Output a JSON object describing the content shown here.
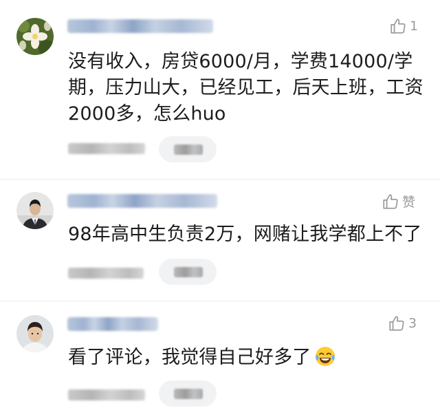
{
  "comments": [
    {
      "avatar": "flower-avatar",
      "like_label": "1",
      "text": "没有收入，房贷6000/月，学费14000/学期，压力山大，已经见工，后天上班，工资2000多，怎么huo"
    },
    {
      "avatar": "suit-man-avatar",
      "like_label": "赞",
      "text": "98年高中生负责2万，网赌让我学都上不了"
    },
    {
      "avatar": "young-man-avatar",
      "like_label": "3",
      "text": "看了评论，我觉得自己好多了",
      "emoji": "laughing-tears-emoji"
    }
  ],
  "icons": {
    "like": "thumbs-up-icon"
  },
  "colors": {
    "muted": "#9a9a9a",
    "pill": "#f1f2f4",
    "text": "#1c1c1c"
  }
}
